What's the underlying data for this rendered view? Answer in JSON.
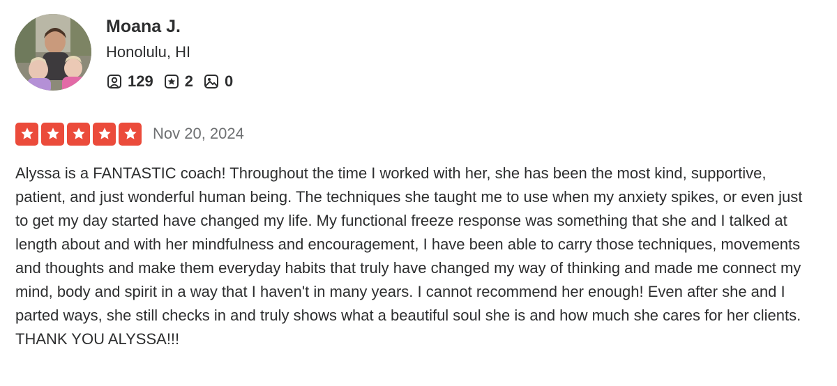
{
  "user": {
    "name": "Moana J.",
    "location": "Honolulu, HI",
    "stats": {
      "friends": "129",
      "reviews": "2",
      "photos": "0"
    }
  },
  "review": {
    "rating": 5,
    "date": "Nov 20, 2024",
    "text": "Alyssa is a FANTASTIC coach! Throughout the time I worked with her, she has been the most kind, supportive, patient, and just wonderful human being. The techniques she taught me to use when my anxiety spikes, or even just to get my day started have changed my life. My functional freeze response was something that she and I talked at length about and with her mindfulness and encouragement, I have been able to carry those techniques, movements and thoughts and make them everyday habits that truly have changed my way of thinking and made me connect my mind, body and spirit in a way that I haven't in many years. I cannot recommend her enough! Even after she and I parted ways, she still checks in and truly shows what a beautiful soul she is and how much she cares for her clients. THANK YOU ALYSSA!!!"
  },
  "colors": {
    "star_red": "#eb4b3b",
    "text_dark": "#2d2e2f",
    "text_muted": "#6e7072"
  },
  "icons": {
    "friends": "friends-icon",
    "reviews": "review-star-icon",
    "photos": "photo-icon",
    "rating_star": "rating-star-icon"
  }
}
